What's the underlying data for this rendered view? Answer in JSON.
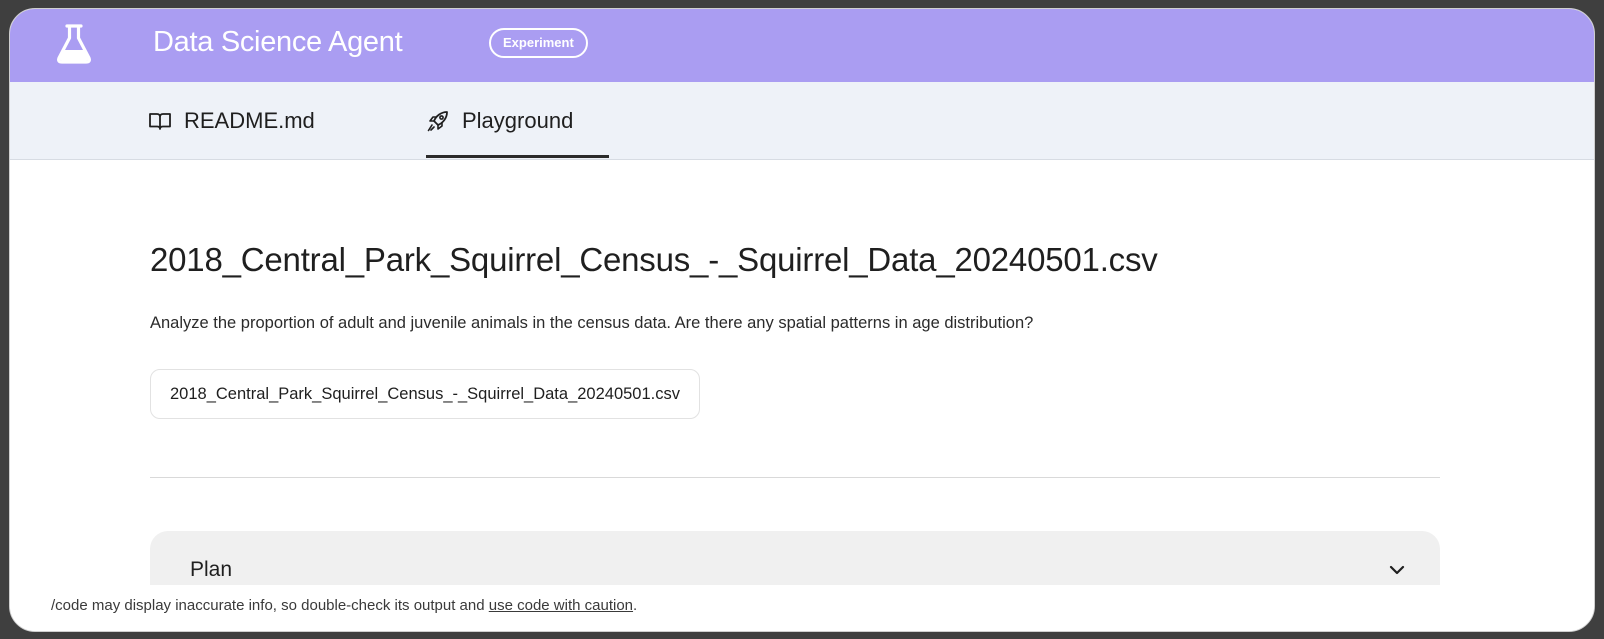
{
  "header": {
    "app_title": "Data Science Agent",
    "badge": "Experiment",
    "icon": "flask-icon"
  },
  "tabs": [
    {
      "label": "README.md",
      "icon": "book-icon",
      "active": false
    },
    {
      "label": "Playground",
      "icon": "rocket-icon",
      "active": true
    }
  ],
  "main": {
    "file_title": "2018_Central_Park_Squirrel_Census_-_Squirrel_Data_20240501.csv",
    "prompt": "Analyze the proportion of adult and juvenile animals in the census data. Are there any spatial patterns in age distribution?",
    "file_chip": "2018_Central_Park_Squirrel_Census_-_Squirrel_Data_20240501.csv"
  },
  "plan": {
    "label": "Plan",
    "icon": "chevron-down-icon"
  },
  "footer": {
    "disclaimer_text": "/code may display inaccurate info, so double-check its output and ",
    "disclaimer_link": "use code with caution",
    "disclaimer_end": "."
  },
  "colors": {
    "header_bg": "#aa9df2",
    "tabs_bg": "#eef2f8",
    "plan_bg": "#f0f0f0"
  }
}
